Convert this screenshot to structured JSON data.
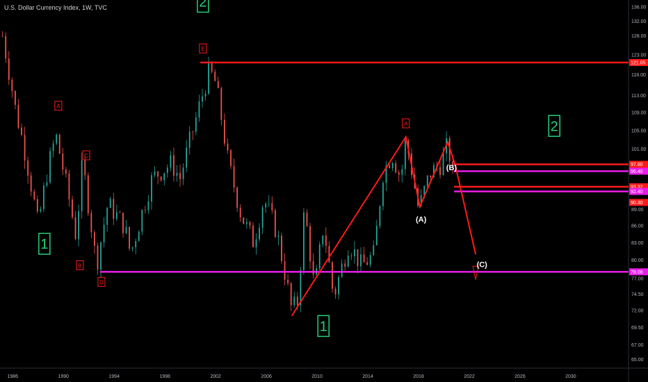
{
  "header": {
    "title": "U.S. Dollar Currency Index, 1W, TVC"
  },
  "colors": {
    "background": "#000000",
    "up": "#26a69a",
    "down": "#ef5350",
    "red": "#ff1a1a",
    "magenta": "#e91ee9",
    "green": "#26d07c"
  },
  "chart_data": {
    "type": "candlestick",
    "title": "U.S. Dollar Currency Index, 1W, TVC",
    "x_ticks": [
      "1986",
      "1990",
      "1994",
      "1998",
      "2002",
      "2006",
      "2010",
      "2014",
      "2018",
      "2022",
      "2026",
      "2030"
    ],
    "y_ticks": [
      "136.00",
      "132.00",
      "128.00",
      "123.00",
      "118.00",
      "113.00",
      "109.00",
      "105.00",
      "101.00",
      "97.00",
      "93.00",
      "89.00",
      "86.00",
      "83.00",
      "80.00",
      "77.00",
      "74.50",
      "72.00",
      "69.50",
      "67.00",
      "65.00"
    ],
    "xlim": [
      1985.0,
      2034.5
    ],
    "ylim": [
      64.0,
      138.0
    ],
    "scale": "log",
    "price_path": [
      [
        1985.2,
        128.0
      ],
      [
        1986.2,
        110.0
      ],
      [
        1987.0,
        100.0
      ],
      [
        1988.0,
        86.0
      ],
      [
        1988.7,
        96.0
      ],
      [
        1989.4,
        104.0
      ],
      [
        1990.2,
        94.0
      ],
      [
        1991.0,
        84.0
      ],
      [
        1991.5,
        98.0
      ],
      [
        1992.6,
        79.0
      ],
      [
        1993.5,
        90.0
      ],
      [
        1994.8,
        86.0
      ],
      [
        1995.3,
        81.0
      ],
      [
        1997.0,
        95.0
      ],
      [
        1998.5,
        98.0
      ],
      [
        1999.2,
        95.0
      ],
      [
        2000.3,
        106.0
      ],
      [
        2001.5,
        119.0
      ],
      [
        2002.0,
        116.0
      ],
      [
        2003.0,
        98.0
      ],
      [
        2004.0,
        88.0
      ],
      [
        2005.0,
        83.0
      ],
      [
        2005.8,
        91.0
      ],
      [
        2006.8,
        85.0
      ],
      [
        2008.0,
        72.0
      ],
      [
        2008.5,
        73.5
      ],
      [
        2009.0,
        89.0
      ],
      [
        2009.8,
        75.0
      ],
      [
        2010.5,
        86.0
      ],
      [
        2011.3,
        74.0
      ],
      [
        2012.5,
        83.0
      ],
      [
        2013.5,
        79.0
      ],
      [
        2014.5,
        81.0
      ],
      [
        2015.2,
        96.0
      ],
      [
        2015.9,
        100.0
      ],
      [
        2016.6,
        95.0
      ],
      [
        2017.0,
        103.0
      ],
      [
        2018.0,
        89.0
      ],
      [
        2018.9,
        96.0
      ],
      [
        2019.8,
        98.0
      ],
      [
        2020.3,
        102.0
      ],
      [
        2020.9,
        92.5
      ]
    ],
    "price_lines": [
      {
        "value": 121.05,
        "label": "121.05",
        "color": "#ff1a1a"
      },
      {
        "value": 97.8,
        "label": "97.80",
        "color": "#ff1a1a"
      },
      {
        "value": 96.4,
        "label": "96.40",
        "color": "#e91ee9"
      },
      {
        "value": 93.32,
        "label": "93.32",
        "color": "#ff1a1a"
      },
      {
        "value": 92.4,
        "label": "92.40",
        "color": "#e91ee9"
      },
      {
        "value": 78.08,
        "label": "78.08",
        "color": "#e91ee9"
      }
    ],
    "axis_only_labels": [
      {
        "value": 90.3,
        "label": "90.30",
        "color": "#ff1a1a"
      }
    ],
    "wave_lines": [
      {
        "color": "#ff1a1a",
        "points": [
          [
            2008.0,
            71.2
          ],
          [
            2017.0,
            103.6
          ],
          [
            2018.1,
            89.5
          ],
          [
            2020.3,
            102.5
          ],
          [
            2020.9,
            97.6
          ],
          [
            2022.5,
            81.0
          ]
        ]
      }
    ],
    "wave_labels": [
      {
        "text": "2",
        "x": 2001.0,
        "y": 137.5,
        "style": "green-box"
      },
      {
        "text": "E",
        "x": 2001.0,
        "y": 124.6,
        "style": "red-box"
      },
      {
        "text": "A",
        "x": 1989.6,
        "y": 110.5,
        "style": "red-box"
      },
      {
        "text": "C",
        "x": 1991.8,
        "y": 99.6,
        "style": "red-box"
      },
      {
        "text": "1",
        "x": 1988.5,
        "y": 82.8,
        "style": "green-box"
      },
      {
        "text": "B",
        "x": 1991.3,
        "y": 79.1,
        "style": "red-box"
      },
      {
        "text": "D",
        "x": 1993.0,
        "y": 76.4,
        "style": "red-box"
      },
      {
        "text": "A",
        "x": 2017.0,
        "y": 106.5,
        "style": "red-box"
      },
      {
        "text": "2",
        "x": 2028.7,
        "y": 106.0,
        "style": "green-box"
      },
      {
        "text": "(B)",
        "x": 2020.6,
        "y": 97.2,
        "style": "text-white"
      },
      {
        "text": "(A)",
        "x": 2018.2,
        "y": 87.2,
        "style": "text-white"
      },
      {
        "text": "(C)",
        "x": 2023.0,
        "y": 79.3,
        "style": "text-white"
      },
      {
        "text": "1",
        "x": 2010.5,
        "y": 69.7,
        "style": "green-box"
      }
    ]
  }
}
